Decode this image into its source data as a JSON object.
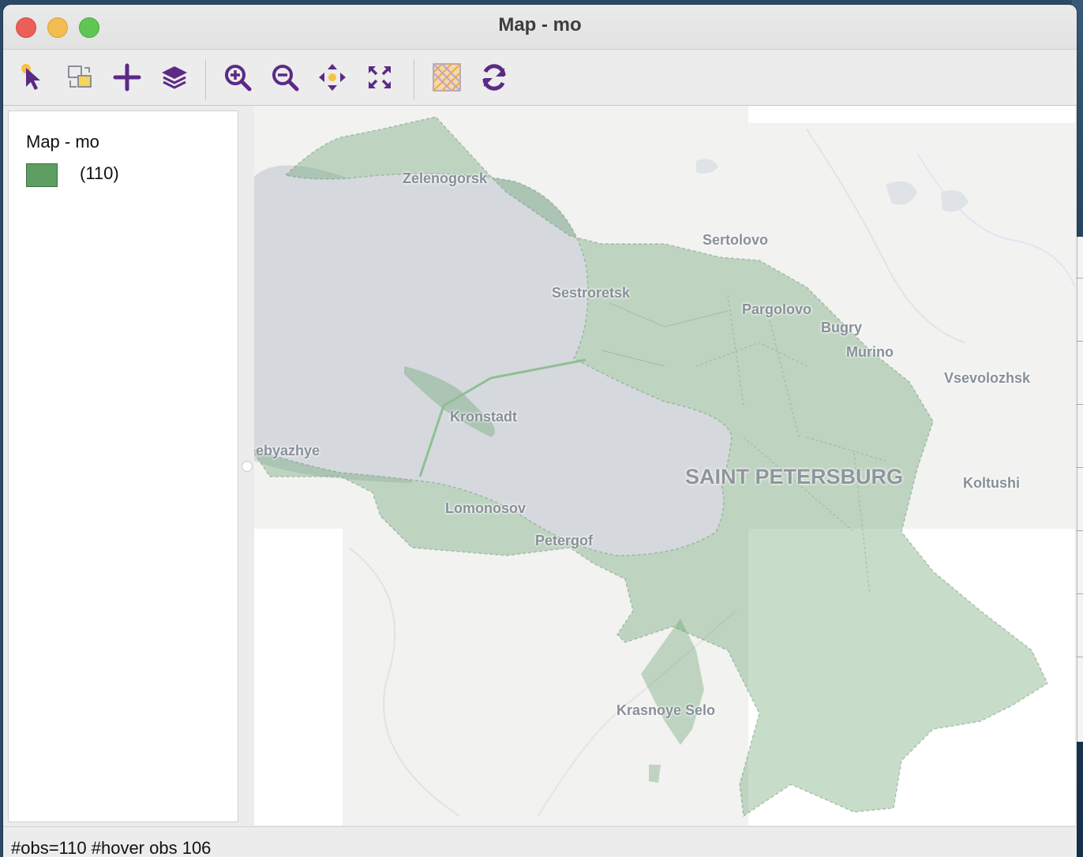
{
  "window": {
    "title": "Map - mo"
  },
  "toolbar": {
    "buttons": [
      {
        "name": "select-tool-button",
        "icon": "pointer-select-icon"
      },
      {
        "name": "copy-image-button",
        "icon": "copy-image-icon"
      },
      {
        "name": "add-button",
        "icon": "plus-icon"
      },
      {
        "name": "layers-button",
        "icon": "layers-icon"
      },
      {
        "name": "zoom-in-button",
        "icon": "zoom-in-icon"
      },
      {
        "name": "zoom-out-button",
        "icon": "zoom-out-icon"
      },
      {
        "name": "pan-button",
        "icon": "pan-arrows-icon"
      },
      {
        "name": "full-extent-button",
        "icon": "full-extent-icon"
      },
      {
        "name": "basemap-button",
        "icon": "basemap-icon"
      },
      {
        "name": "refresh-button",
        "icon": "refresh-icon"
      }
    ],
    "accent_color": "#5b2a86"
  },
  "legend": {
    "title": "Map - mo",
    "items": [
      {
        "count_label": "(110)",
        "color": "#5e9e63"
      }
    ]
  },
  "map": {
    "fill_color": "#5e9e63",
    "labels": [
      {
        "name": "map-label-zelenogorsk",
        "text": "Zelenogorsk"
      },
      {
        "name": "map-label-sertolovo",
        "text": "Sertolovo"
      },
      {
        "name": "map-label-sestroretsk",
        "text": "Sestroretsk"
      },
      {
        "name": "map-label-pargolovo",
        "text": "Pargolovo"
      },
      {
        "name": "map-label-bugry",
        "text": "Bugry"
      },
      {
        "name": "map-label-murino",
        "text": "Murino"
      },
      {
        "name": "map-label-vsevolozhsk",
        "text": "Vsevolozhsk"
      },
      {
        "name": "map-label-kronstadt",
        "text": "Kronstadt"
      },
      {
        "name": "map-label-lebyazhye",
        "text": "ebyazhye"
      },
      {
        "name": "map-label-saint-petersburg",
        "text": "SAINT PETERSBURG"
      },
      {
        "name": "map-label-koltushi",
        "text": "Koltushi"
      },
      {
        "name": "map-label-lomonosov",
        "text": "Lomonosov"
      },
      {
        "name": "map-label-petergof",
        "text": "Petergof"
      },
      {
        "name": "map-label-krasnoye-selo",
        "text": "Krasnoye Selo"
      }
    ]
  },
  "status": {
    "text": "#obs=110 #hover obs 106"
  }
}
